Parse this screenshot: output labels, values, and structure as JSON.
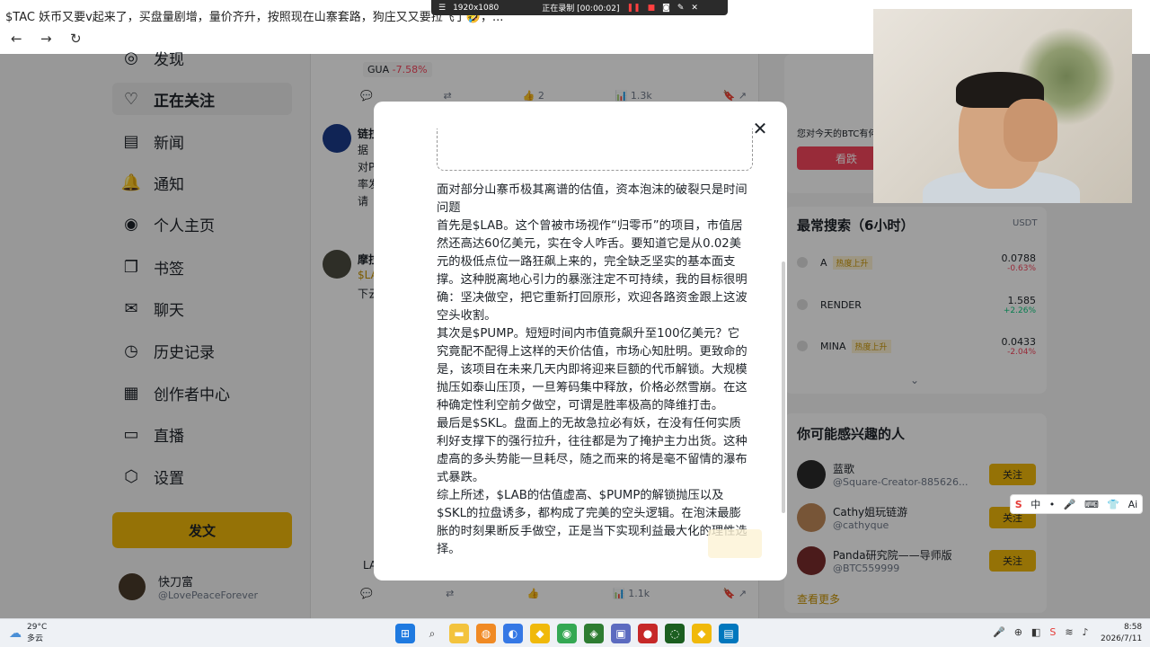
{
  "window": {
    "title": "$TAC 妖币又要v起来了，买盘量剧增，量价齐升，按照现在山寨套路，狗庄又又要拉飞了🤣，..."
  },
  "recorder": {
    "resolution": "1920x1080",
    "status": "正在录制 [00:00:02]"
  },
  "nav": {
    "back": "←",
    "forward": "→",
    "reload": "↻"
  },
  "sidebar": {
    "items": [
      {
        "label": "发现",
        "icon": "compass-icon",
        "glyph": "◎"
      },
      {
        "label": "正在关注",
        "icon": "user-heart-icon",
        "glyph": "♡"
      },
      {
        "label": "新闻",
        "icon": "news-icon",
        "glyph": "▤"
      },
      {
        "label": "通知",
        "icon": "bell-icon",
        "glyph": "🔔"
      },
      {
        "label": "个人主页",
        "icon": "user-icon",
        "glyph": "◉"
      },
      {
        "label": "书签",
        "icon": "bookmark-icon",
        "glyph": "❐"
      },
      {
        "label": "聊天",
        "icon": "mail-icon",
        "glyph": "✉"
      },
      {
        "label": "历史记录",
        "icon": "clock-icon",
        "glyph": "◷"
      },
      {
        "label": "创作者中心",
        "icon": "grid-icon",
        "glyph": "▦"
      },
      {
        "label": "直播",
        "icon": "video-icon",
        "glyph": "▭"
      },
      {
        "label": "设置",
        "icon": "gear-icon",
        "glyph": "⬡"
      }
    ],
    "post_button": "发文",
    "profile": {
      "name": "快刀富",
      "handle": "@LovePeaceForever",
      "more": "···"
    }
  },
  "feed": {
    "tag_symbol": "GUA",
    "tag_change": "-7.58%",
    "row1": {
      "likes": "2",
      "views": "1.3k"
    },
    "post2_name": "链拉",
    "post2_lines": [
      "据",
      "对P",
      "率发",
      "请"
    ],
    "post3_name": "摩拉",
    "post3_lines": [
      "$LA",
      "下云"
    ],
    "row3": {
      "views": "1.1k"
    },
    "row3_prefix": "LA"
  },
  "modal": {
    "close": "✕",
    "paragraphs": [
      "面对部分山寨币极其离谱的估值，资本泡沫的破裂只是时间问题",
      "首先是$LAB。这个曾被市场视作“归零币”的项目，市值居然还高达60亿美元，实在令人咋舌。要知道它是从0.02美元的极低点位一路狂飙上来的，完全缺乏坚实的基本面支撑。这种脱离地心引力的暴涨注定不可持续，我的目标很明确：坚决做空，把它重新打回原形，欢迎各路资金跟上这波空头收割。",
      "其次是$PUMP。短短时间内市值竟飙升至100亿美元？它究竟配不配得上这样的天价估值，市场心知肚明。更致命的是，该项目在未来几天内即将迎来巨额的代币解锁。大规模抛压如泰山压顶，一旦筹码集中释放，价格必然雪崩。在这种确定性利空前夕做空，可谓是胜率极高的降维打击。",
      "最后是$SKL。盘面上的无故急拉必有妖，在没有任何实质利好支撑下的强行拉升，往往都是为了掩护主力出货。这种虚高的多头势能一旦耗尽，随之而来的将是毫不留情的瀑布式暴跌。",
      "综上所述，$LAB的估值虚高、$PUMP的解锁抛压以及$SKL的拉盘诱多，都构成了完美的空头逻辑。在泡沫最膨胀的时刻果断反手做空，正是当下实现利益最大化的理性选择。"
    ]
  },
  "right": {
    "poll_question": "您对今天的BTC有何",
    "bear_button": "看跌",
    "search_title": "最常搜索（6小时）",
    "search_unit": "USDT",
    "coins": [
      {
        "name": "A",
        "hot": "热度上升",
        "price": "0.0788",
        "change": "-0.63%",
        "dir": "neg"
      },
      {
        "name": "RENDER",
        "hot": "",
        "price": "1.585",
        "change": "+2.26%",
        "dir": "pos"
      },
      {
        "name": "MINA",
        "hot": "热度上升",
        "price": "0.0433",
        "change": "-2.04%",
        "dir": "neg"
      }
    ],
    "expand": "⌄",
    "people_title": "你可能感兴趣的人",
    "people": [
      {
        "name": "蓝歌",
        "handle": "@Square-Creator-885626...",
        "color": "#2a2a2a"
      },
      {
        "name": "Cathy姐玩链游",
        "handle": "@cathyque",
        "color": "#c08a5a"
      },
      {
        "name": "Panda研究院——导师版",
        "handle": "@BTC559999",
        "color": "#7a2d2d"
      }
    ],
    "follow_label": "关注",
    "see_more": "查看更多"
  },
  "ime": {
    "items": [
      "S",
      "中",
      "•",
      "🎤",
      "⌨",
      "👕",
      "Ai"
    ]
  },
  "taskbar": {
    "temp": "29°C",
    "weather": "多云",
    "time": "8:58",
    "date": "2026/7/11"
  }
}
